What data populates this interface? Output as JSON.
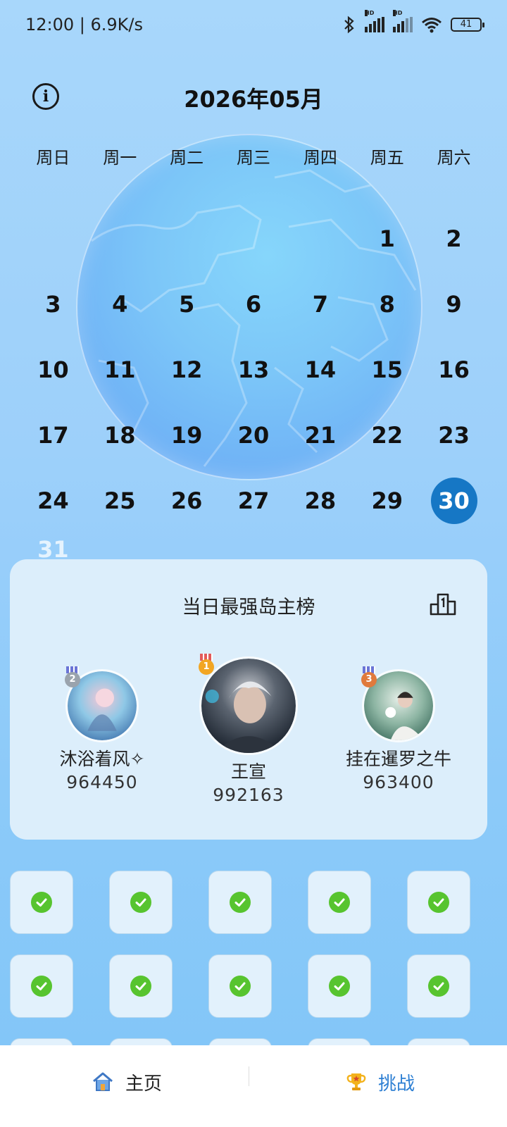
{
  "status_bar": {
    "time_speed": "12:00 | 6.9K/s",
    "signal_hd_1": "HD",
    "signal_hd_2": "HD",
    "battery": "41"
  },
  "header": {
    "month_title": "2026年05月"
  },
  "calendar": {
    "weekdays": [
      "周日",
      "周一",
      "周二",
      "周三",
      "周四",
      "周五",
      "周六"
    ],
    "days": [
      "",
      "",
      "",
      "",
      "",
      "1",
      "2",
      "3",
      "4",
      "5",
      "6",
      "7",
      "8",
      "9",
      "10",
      "11",
      "12",
      "13",
      "14",
      "15",
      "16",
      "17",
      "18",
      "19",
      "20",
      "21",
      "22",
      "23",
      "24",
      "25",
      "26",
      "27",
      "28",
      "29",
      "30",
      "31"
    ],
    "selected_day": "30"
  },
  "ranking": {
    "title": "当日最强岛主榜",
    "players": [
      {
        "rank": "2",
        "name": "沐浴着风✧",
        "score": "964450"
      },
      {
        "rank": "1",
        "name": "王宣",
        "score": "992163"
      },
      {
        "rank": "3",
        "name": "挂在暹罗之牛",
        "score": "963400"
      }
    ]
  },
  "tiles": {
    "rows": 3,
    "completed_count": 10
  },
  "bottom_nav": {
    "home_label": "主页",
    "challenge_label": "挑战"
  },
  "colors": {
    "selected_day_bg": "#1677c5",
    "check_green": "#57c42f",
    "challenge_blue": "#2d7fd3",
    "card_bg": "#dceefb"
  }
}
